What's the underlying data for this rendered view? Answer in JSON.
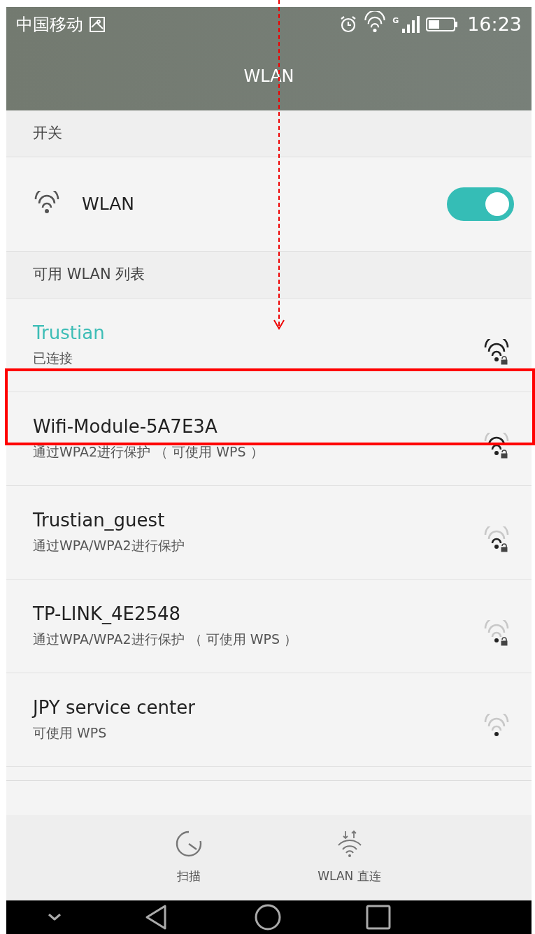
{
  "status_bar": {
    "carrier": "中国移动",
    "network_type": "G",
    "time": "16:23"
  },
  "title": "WLAN",
  "switch_section": {
    "header": "开关",
    "label": "WLAN",
    "on": true
  },
  "list_header": "可用 WLAN 列表",
  "networks": [
    {
      "name": "Trustian",
      "detail": "已连接",
      "connected": true,
      "secured": true,
      "kind": "full"
    },
    {
      "name": "Wifi-Module-5A7E3A",
      "detail": "通过WPA2进行保护 （ 可使用 WPS ）",
      "connected": false,
      "secured": true,
      "kind": "good"
    },
    {
      "name": "Trustian_guest",
      "detail": "通过WPA/WPA2进行保护",
      "connected": false,
      "secured": true,
      "kind": "fair"
    },
    {
      "name": "TP-LINK_4E2548",
      "detail": "通过WPA/WPA2进行保护 （ 可使用 WPS ）",
      "connected": false,
      "secured": true,
      "kind": "weak"
    },
    {
      "name": "JPY service center",
      "detail": "可使用 WPS",
      "connected": false,
      "secured": false,
      "kind": "weak"
    }
  ],
  "actions": [
    {
      "kind": "scan",
      "label": "扫描"
    },
    {
      "kind": "direct",
      "label": "WLAN 直连"
    }
  ],
  "annotations": {
    "pointer_arrow": true,
    "highlight_box": true
  }
}
